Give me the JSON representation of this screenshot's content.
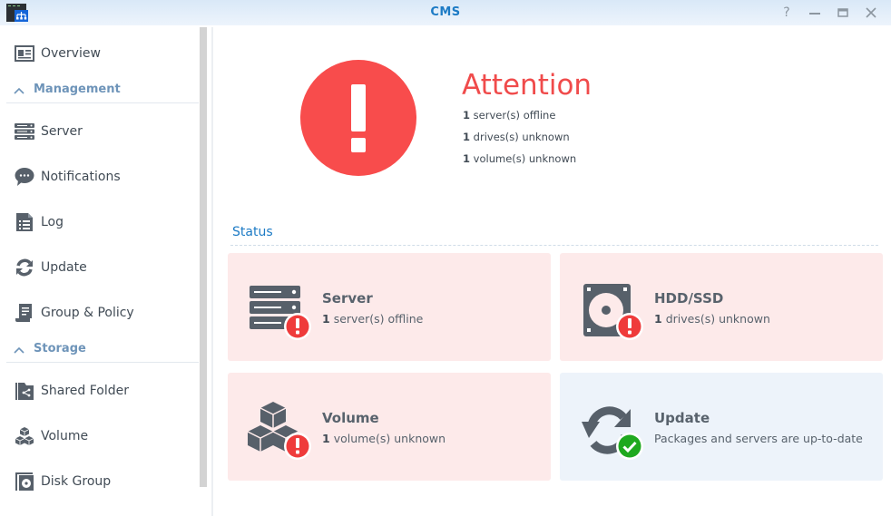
{
  "window": {
    "title": "CMS",
    "buttons": [
      {
        "name": "help",
        "glyph": "?"
      },
      {
        "name": "minimize",
        "glyph": "—"
      },
      {
        "name": "maximize",
        "glyph": "▭"
      },
      {
        "name": "close",
        "glyph": "✕"
      }
    ]
  },
  "sidebar": {
    "overview": {
      "label": "Overview",
      "icon": "overview-icon"
    },
    "sections": [
      {
        "label": "Management",
        "items": [
          {
            "label": "Server",
            "icon": "server-icon"
          },
          {
            "label": "Notifications",
            "icon": "chat-bubble-icon"
          },
          {
            "label": "Log",
            "icon": "log-document-icon"
          },
          {
            "label": "Update",
            "icon": "refresh-icon"
          },
          {
            "label": "Group & Policy",
            "icon": "policy-scroll-icon"
          }
        ]
      },
      {
        "label": "Storage",
        "items": [
          {
            "label": "Shared Folder",
            "icon": "shared-folder-icon"
          },
          {
            "label": "Volume",
            "icon": "cubes-icon"
          },
          {
            "label": "Disk Group",
            "icon": "disk-group-icon"
          }
        ]
      }
    ]
  },
  "summary": {
    "title": "Attention",
    "lines": [
      {
        "count": "1",
        "text": "server(s) offline"
      },
      {
        "count": "1",
        "text": "drives(s) unknown"
      },
      {
        "count": "1",
        "text": "volume(s) unknown"
      }
    ]
  },
  "status": {
    "heading": "Status",
    "cards": [
      {
        "title": "Server",
        "count": "1",
        "text": "server(s) offline",
        "state": "error"
      },
      {
        "title": "HDD/SSD",
        "count": "1",
        "text": "drives(s) unknown",
        "state": "error"
      },
      {
        "title": "Volume",
        "count": "1",
        "text": "volume(s) unknown",
        "state": "error"
      },
      {
        "title": "Update",
        "count": "",
        "text": "Packages and servers are up-to-date",
        "state": "ok"
      }
    ]
  },
  "colors": {
    "accent": "#1d7bc5",
    "error": "#f04b4b",
    "ok": "#1fa91f",
    "error_bg": "#fdeaea",
    "ok_bg": "#edf3fa",
    "icon": "#57606a"
  }
}
